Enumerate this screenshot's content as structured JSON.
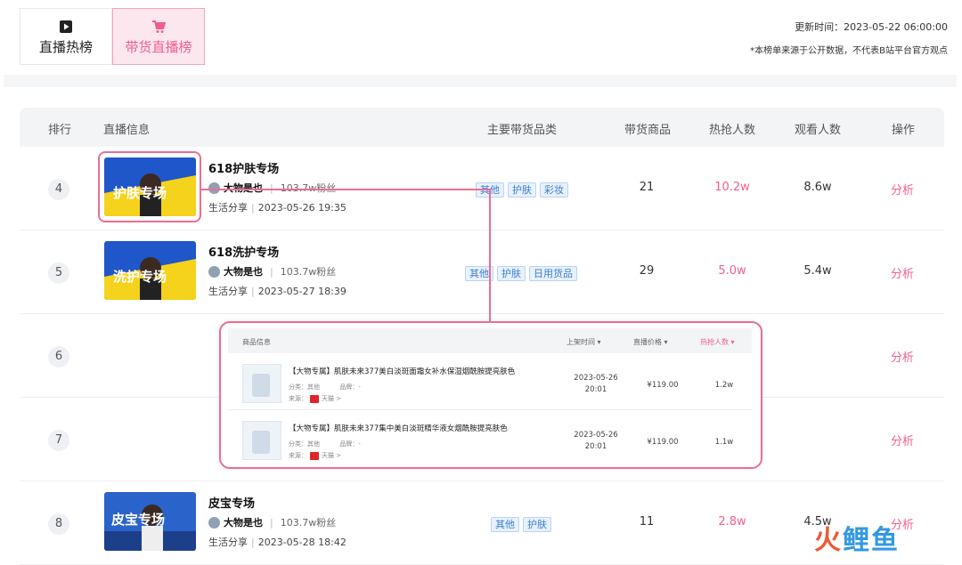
{
  "tabs": [
    {
      "label": "直播热榜",
      "icon": "play-icon",
      "active": false
    },
    {
      "label": "带货直播榜",
      "icon": "cart-icon",
      "active": true
    }
  ],
  "update_time": "更新时间：2023-05-22 06:00:00",
  "disclaimer": "*本榜单来源于公开数据，不代表B站平台官方观点",
  "columns": {
    "rank": "排行",
    "info": "直播信息",
    "category": "主要带货品类",
    "goods": "带货商品",
    "hot": "热抢人数",
    "viewers": "观看人数",
    "action": "操作"
  },
  "rows": [
    {
      "rank": "4",
      "title": "618护肤专场",
      "anchor": "大物是也",
      "fans": "103.7w粉丝",
      "zone": "生活分享",
      "time": "2023-05-26 19:35",
      "tags": [
        "其他",
        "护肤",
        "彩妆"
      ],
      "goods": "21",
      "hot": "10.2w",
      "viewers": "8.6w",
      "action": "分析",
      "thumb_text": "护肤专场"
    },
    {
      "rank": "5",
      "title": "618洗护专场",
      "anchor": "大物是也",
      "fans": "103.7w粉丝",
      "zone": "生活分享",
      "time": "2023-05-27 18:39",
      "tags": [
        "其他",
        "护肤",
        "日用货品"
      ],
      "goods": "29",
      "hot": "5.0w",
      "viewers": "5.4w",
      "action": "分析",
      "thumb_text": "洗护专场"
    },
    {
      "rank": "6",
      "action": "分析"
    },
    {
      "rank": "7",
      "action": "分析"
    },
    {
      "rank": "8",
      "title": "皮宝专场",
      "anchor": "大物是也",
      "fans": "103.7w粉丝",
      "zone": "生活分享",
      "time": "2023-05-28 18:42",
      "tags": [
        "其他",
        "护肤"
      ],
      "goods": "11",
      "hot": "2.8w",
      "viewers": "4.5w",
      "action": "分析",
      "thumb_text": "皮宝专场"
    }
  ],
  "popup": {
    "header": {
      "info": "商品信息",
      "time": "上架时间 ▾",
      "price": "直播价格 ▾",
      "hot": "热抢人数 ▾"
    },
    "items": [
      {
        "name": "【大物专属】肌肤未来377美白淡斑面霜女补水保湿烟酰胺提亮肤色",
        "category": "分类：其他",
        "brand": "品牌：-",
        "source": "来源：",
        "shop": "天猫 >",
        "date": "2023-05-26",
        "clock": "20:01",
        "price": "¥119.00",
        "hot": "1.2w"
      },
      {
        "name": "【大物专属】肌肤未来377集中美白淡斑精华液女烟酰胺提亮肤色",
        "category": "分类：其他",
        "brand": "品牌：-",
        "source": "来源：",
        "shop": "天猫 >",
        "date": "2023-05-26",
        "clock": "20:01",
        "price": "¥119.00",
        "hot": "1.1w"
      }
    ]
  },
  "colors": {
    "accent": "#f2608a",
    "tag": "#3b7fd0"
  }
}
